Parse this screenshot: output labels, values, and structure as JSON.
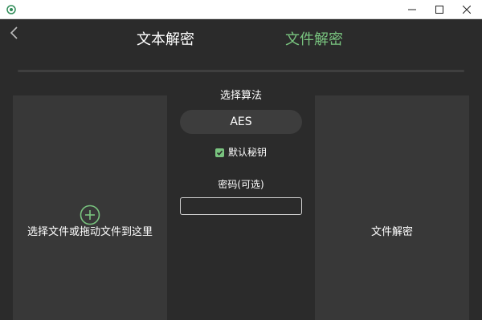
{
  "window": {
    "minimize_icon": "minimize-icon",
    "maximize_icon": "maximize-icon",
    "close_icon": "close-icon"
  },
  "header": {
    "back_icon": "chevron-left-icon",
    "tabs": [
      {
        "label": "文本解密",
        "active": false
      },
      {
        "label": "文件解密",
        "active": true
      }
    ]
  },
  "left_panel": {
    "icon": "plus-circle-icon",
    "label": "选择文件或拖动文件到这里"
  },
  "settings": {
    "algorithm_title": "选择算法",
    "algorithm_value": "AES",
    "default_key_label": "默认秘钥",
    "default_key_checked": true,
    "password_label": "密码(可选)",
    "password_value": "",
    "password_placeholder": ""
  },
  "right_panel": {
    "label": "文件解密"
  },
  "colors": {
    "background": "#2b2b2b",
    "panel": "#383838",
    "accent": "#79c47f",
    "text": "#ffffff"
  }
}
